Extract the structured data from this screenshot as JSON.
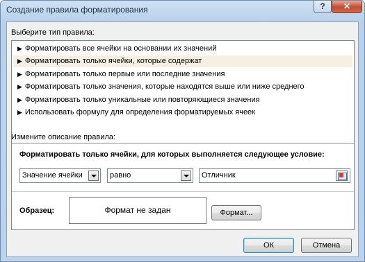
{
  "window": {
    "title": "Создание правила форматирования",
    "help_button": "?",
    "close_button": "✕"
  },
  "select_type": {
    "label": "Выберите тип правила:",
    "rules": [
      {
        "label": "Форматировать все ячейки на основании их значений",
        "selected": false
      },
      {
        "label": "Форматировать только ячейки, которые содержат",
        "selected": true
      },
      {
        "label": "Форматировать только первые или последние значения",
        "selected": false
      },
      {
        "label": "Форматировать только значения, которые находятся выше или ниже среднего",
        "selected": false
      },
      {
        "label": "Форматировать только уникальные или повторяющиеся значения",
        "selected": false
      },
      {
        "label": "Использовать формулу для определения форматируемых ячеек",
        "selected": false
      }
    ]
  },
  "edit": {
    "label": "Измените описание правила:",
    "condition_title": "Форматировать только ячейки, для которых выполняется следующее условие:",
    "field_combo": "Значение ячейки",
    "operator_combo": "равно",
    "value_input": "Отличник",
    "preview_label": "Образец:",
    "preview_text": "Формат не задан",
    "format_button": "Формат..."
  },
  "buttons": {
    "ok": "ОК",
    "cancel": "Отмена"
  }
}
